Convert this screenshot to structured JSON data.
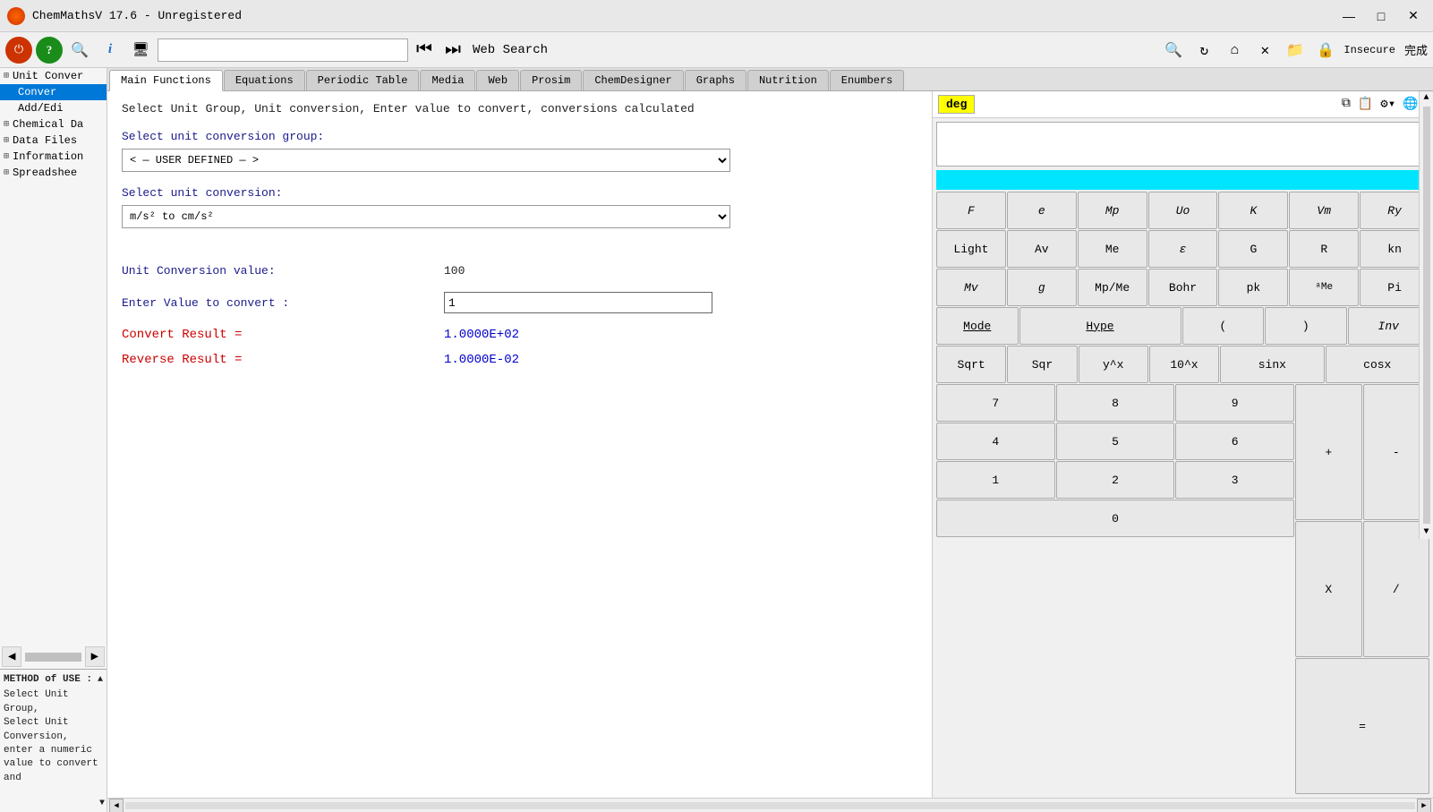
{
  "titlebar": {
    "title": "ChemMathsV 17.6 - Unregistered",
    "icon": "●",
    "minimize": "—",
    "maximize": "□",
    "close": "✕"
  },
  "toolbar": {
    "icon1": "⏻",
    "icon2": "?",
    "icon3": "🔍",
    "icon4": "ℹ",
    "icon5": "📺",
    "nav_back": "⏮",
    "nav_fwd": "⏭",
    "web_search": "Web Search",
    "right_icons": [
      "🔍",
      "↻",
      "⌂",
      "✕",
      "📁",
      "🔒"
    ],
    "insecure": "Insecure",
    "kanryo": "完成"
  },
  "sidebar": {
    "items": [
      {
        "label": "Unit Conver",
        "expanded": true,
        "indent": 0
      },
      {
        "label": "Conver",
        "selected": true,
        "indent": 1
      },
      {
        "label": "Add/Edi",
        "indent": 1
      },
      {
        "label": "Chemical Da",
        "expanded": true,
        "indent": 0
      },
      {
        "label": "Data Files",
        "expanded": true,
        "indent": 0
      },
      {
        "label": "Information",
        "expanded": true,
        "indent": 0
      },
      {
        "label": "Spreadshee",
        "expanded": true,
        "indent": 0
      }
    ],
    "method_header": "METHOD of USE :",
    "method_text": "Select Unit Group, Select Unit Conversion, enter a numeric value to convert and"
  },
  "tabs": [
    {
      "label": "Main Functions",
      "active": true
    },
    {
      "label": "Equations"
    },
    {
      "label": "Periodic Table"
    },
    {
      "label": "Media"
    },
    {
      "label": "Web"
    },
    {
      "label": "Prosim"
    },
    {
      "label": "ChemDesigner"
    },
    {
      "label": "Graphs"
    },
    {
      "label": "Nutrition"
    },
    {
      "label": "Enumbers"
    }
  ],
  "page": {
    "description": "Select Unit Group, Unit conversion, Enter value to convert, conversions calculated",
    "group_label": "Select unit conversion group:",
    "group_value": "< — USER DEFINED — >",
    "conversion_label": "Select unit conversion:",
    "conversion_value": "m/s² to cm/s²",
    "unit_value_label": "Unit Conversion value:",
    "unit_value": "100",
    "enter_value_label": "Enter Value to convert :",
    "enter_value": "1",
    "convert_result_label": "Convert Result =",
    "convert_result": "1.0000E+02",
    "reverse_result_label": "Reverse Result =",
    "reverse_result": "1.0000E-02"
  },
  "calculator": {
    "deg_label": "deg",
    "display": "",
    "cyan_bar": "",
    "rows": [
      [
        {
          "label": "F",
          "italic": true
        },
        {
          "label": "e",
          "italic": true
        },
        {
          "label": "Mp",
          "italic": true
        },
        {
          "label": "Uo",
          "italic": true
        },
        {
          "label": "K",
          "italic": true
        },
        {
          "label": "Vm",
          "italic": true
        },
        {
          "label": "Ry",
          "italic": true
        }
      ],
      [
        {
          "label": "Light"
        },
        {
          "label": "Av"
        },
        {
          "label": "Me"
        },
        {
          "label": "ε",
          "italic": true
        },
        {
          "label": "G"
        },
        {
          "label": "R"
        },
        {
          "label": "kn"
        }
      ],
      [
        {
          "label": "Mv",
          "italic": true
        },
        {
          "label": "g",
          "italic": true
        },
        {
          "label": "Mp/Me"
        },
        {
          "label": "Bohr"
        },
        {
          "label": "pk"
        },
        {
          "label": "ᵃMe"
        },
        {
          "label": "Pi"
        }
      ],
      [
        {
          "label": "Mode",
          "underline": true
        },
        {
          "label": "Hype",
          "underline": true,
          "wide": true
        },
        {
          "label": "("
        },
        {
          "label": ")"
        },
        {
          "label": "Inv",
          "italic": true
        }
      ],
      [
        {
          "label": "Sqrt"
        },
        {
          "label": "Sqr"
        },
        {
          "label": "y^x"
        },
        {
          "label": "10^x"
        },
        {
          "label": "sinx",
          "wide": false
        },
        {
          "label": "cosx"
        }
      ],
      [
        {
          "label": "7"
        },
        {
          "label": "8"
        },
        {
          "label": "9"
        },
        {
          "label": "+",
          "rowspan": true
        },
        {
          "label": "-",
          "rowspan": true
        }
      ],
      [
        {
          "label": "4"
        },
        {
          "label": "5"
        },
        {
          "label": "6"
        },
        {
          "label": "X",
          "rowspan": true
        },
        {
          "label": "/",
          "rowspan": true
        }
      ],
      [
        {
          "label": "1"
        },
        {
          "label": "2"
        },
        {
          "label": "3"
        },
        {
          "label": "=",
          "rowspan": true
        }
      ],
      [
        {
          "label": "0"
        }
      ]
    ]
  }
}
